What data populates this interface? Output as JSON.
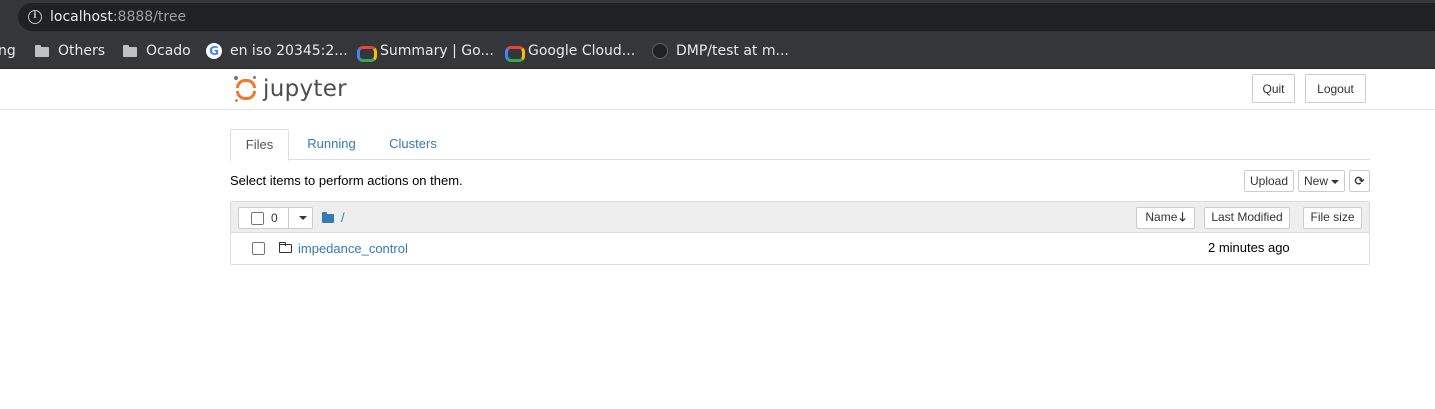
{
  "browser": {
    "url_host": "localhost",
    "url_rest": ":8888/tree",
    "bookmarks": [
      {
        "label": "ng",
        "icon": "truncated"
      },
      {
        "label": "Others",
        "icon": "folder-icon"
      },
      {
        "label": "Ocado",
        "icon": "folder-icon"
      },
      {
        "label": "en iso 20345:2...",
        "icon": "google-icon"
      },
      {
        "label": "Summary | Go...",
        "icon": "google-cloud-icon"
      },
      {
        "label": "Google Cloud...",
        "icon": "google-cloud-icon"
      },
      {
        "label": "DMP/test at m...",
        "icon": "github-icon"
      }
    ]
  },
  "header": {
    "logo_text": "jupyter",
    "quit_label": "Quit",
    "logout_label": "Logout"
  },
  "tabs": [
    {
      "label": "Files",
      "active": true
    },
    {
      "label": "Running",
      "active": false
    },
    {
      "label": "Clusters",
      "active": false
    }
  ],
  "toolbar": {
    "hint": "Select items to perform actions on them.",
    "upload_label": "Upload",
    "new_label": "New",
    "refresh_glyph": "⟳"
  },
  "list_header": {
    "selected_count": "0",
    "path": "/",
    "sort_name_label": "Name",
    "last_modified_label": "Last Modified",
    "file_size_label": "File size"
  },
  "files": [
    {
      "name": "impedance_control",
      "type": "folder",
      "modified": "2 minutes ago"
    }
  ],
  "colors": {
    "link": "#337ab7",
    "jupyter_orange": "#f37726",
    "chrome_dark": "#35363a"
  }
}
